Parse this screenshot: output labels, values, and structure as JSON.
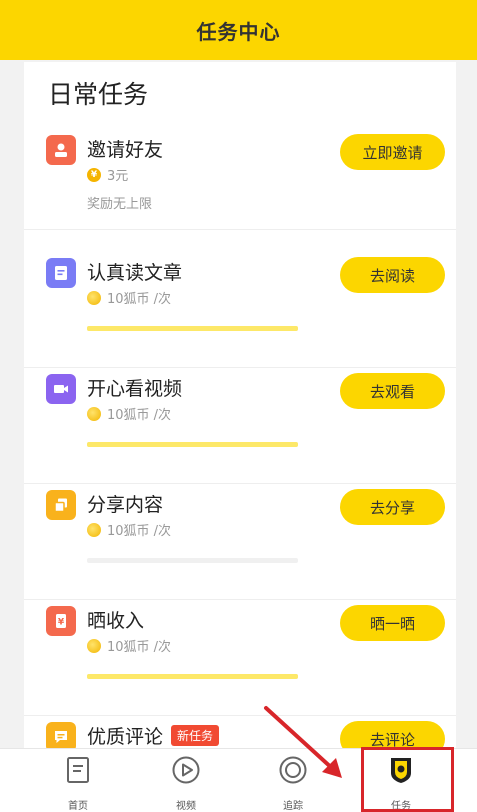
{
  "header": {
    "title": "任务中心"
  },
  "section": {
    "title": "日常任务"
  },
  "tasks": [
    {
      "title": "邀请好友",
      "reward": "3元",
      "note": "奖励无上限",
      "button": "立即邀请",
      "coin_symbol": "¥",
      "icon": "invite-person-icon",
      "icon_color": "#f4694d"
    },
    {
      "title": "认真读文章",
      "reward": "10狐币 /次",
      "button": "去阅读",
      "progress": 1.0,
      "icon": "article-icon",
      "icon_color": "#7a7cf5"
    },
    {
      "title": "开心看视频",
      "reward": "10狐币 /次",
      "button": "去观看",
      "progress": 1.0,
      "icon": "video-icon",
      "icon_color": "#8b64f0"
    },
    {
      "title": "分享内容",
      "reward": "10狐币 /次",
      "button": "去分享",
      "progress": 0.0,
      "icon": "share-icon",
      "icon_color": "#f9b21c"
    },
    {
      "title": "晒收入",
      "reward": "10狐币 /次",
      "button": "晒一晒",
      "progress": 1.0,
      "icon": "income-icon",
      "icon_color": "#f4694d"
    },
    {
      "title": "优质评论",
      "badge": "新任务",
      "button": "去评论",
      "icon": "comment-icon",
      "icon_color": "#f9b21c"
    }
  ],
  "tabbar": {
    "items": [
      {
        "label": "首页",
        "icon": "home-icon"
      },
      {
        "label": "视频",
        "icon": "play-icon"
      },
      {
        "label": "追踪",
        "icon": "track-icon"
      },
      {
        "label": "任务",
        "icon": "task-badge-icon"
      }
    ]
  },
  "colors": {
    "accent": "#fcd600",
    "progress": "#fde868",
    "highlight": "#d8262a"
  }
}
